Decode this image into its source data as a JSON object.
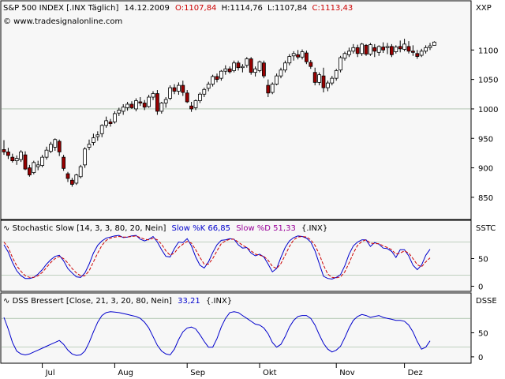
{
  "colors": {
    "panel_bg": "#f7f7f7",
    "frame": "#000000",
    "up_candle": "#ffffff",
    "down_candle": "#990000",
    "red_text": "#cc0000",
    "blue": "#0000cc",
    "purple": "#990099",
    "line_blue": "#0000cc",
    "line_red": "#cc0000",
    "refline": "#88aa88"
  },
  "header": {
    "instrument": "S&P 500 INDEX [.INX  Täglich]",
    "date": "14.12.2009",
    "open": "O:1107,84",
    "high": "H:1114,76",
    "low": "L:1107,84",
    "close": "C:1113,43",
    "watermark": "© www.tradesignalonline.com"
  },
  "stoch_header": {
    "name": "Stochastic Slow [14, 3, 3, 80, 20, Nein]",
    "k_label": "Slow %K 66,85",
    "d_label": "Slow %D 51,33",
    "suffix": "{.INX}"
  },
  "dss_header": {
    "name": "DSS Bressert [Close, 21, 3, 20, 80, Nein]",
    "value": "33,21",
    "suffix": "{.INX}"
  },
  "axis_titles": {
    "price": "XXP",
    "stoch": "SSTC",
    "dss": "DSSE"
  },
  "chart_data": [
    {
      "type": "candlestick",
      "title": "S&P 500 INDEX [.INX  Täglich]",
      "ylim": [
        815,
        1150
      ],
      "y_ticks": [
        "1100",
        "1050",
        "1000",
        "950",
        "900",
        "850"
      ],
      "x_ticks": [
        "Jul",
        "Aug",
        "Sep",
        "Okt",
        "Nov",
        "Dez"
      ],
      "ohlc": [
        [
          931,
          947,
          922,
          927
        ],
        [
          927,
          934,
          915,
          921
        ],
        [
          918,
          924,
          909,
          912
        ],
        [
          912,
          921,
          905,
          916
        ],
        [
          914,
          930,
          910,
          927
        ],
        [
          922,
          928,
          896,
          898
        ],
        [
          900,
          905,
          885,
          888
        ],
        [
          892,
          912,
          889,
          909
        ],
        [
          902,
          912,
          896,
          905
        ],
        [
          904,
          922,
          901,
          918
        ],
        [
          918,
          936,
          914,
          930
        ],
        [
          928,
          944,
          925,
          940
        ],
        [
          935,
          950,
          929,
          948
        ],
        [
          945,
          948,
          920,
          927
        ],
        [
          918,
          922,
          895,
          899
        ],
        [
          890,
          893,
          876,
          882
        ],
        [
          879,
          883,
          868,
          872
        ],
        [
          874,
          890,
          871,
          888
        ],
        [
          885,
          905,
          882,
          902
        ],
        [
          905,
          935,
          900,
          932
        ],
        [
          935,
          948,
          930,
          940
        ],
        [
          943,
          958,
          938,
          951
        ],
        [
          953,
          962,
          946,
          956
        ],
        [
          958,
          974,
          952,
          972
        ],
        [
          972,
          987,
          968,
          980
        ],
        [
          978,
          983,
          970,
          975
        ],
        [
          978,
          996,
          975,
          992
        ],
        [
          993,
          1002,
          988,
          998
        ],
        [
          996,
          1008,
          990,
          1003
        ],
        [
          1002,
          1012,
          997,
          1008
        ],
        [
          1008,
          1013,
          1000,
          1002
        ],
        [
          1000,
          1018,
          996,
          1014
        ],
        [
          1012,
          1020,
          1005,
          1010
        ],
        [
          1010,
          1015,
          998,
          1003
        ],
        [
          1004,
          1024,
          1002,
          1020
        ],
        [
          1020,
          1030,
          1015,
          1026
        ],
        [
          1026,
          1032,
          990,
          996
        ],
        [
          996,
          1012,
          992,
          1010
        ],
        [
          1010,
          1020,
          1002,
          1016
        ],
        [
          1018,
          1040,
          1015,
          1036
        ],
        [
          1036,
          1042,
          1025,
          1030
        ],
        [
          1030,
          1045,
          1024,
          1040
        ],
        [
          1040,
          1048,
          1022,
          1028
        ],
        [
          1027,
          1032,
          1010,
          1012
        ],
        [
          1005,
          1012,
          995,
          1000
        ],
        [
          1002,
          1016,
          998,
          1014
        ],
        [
          1014,
          1028,
          1010,
          1025
        ],
        [
          1025,
          1036,
          1020,
          1033
        ],
        [
          1035,
          1046,
          1030,
          1042
        ],
        [
          1042,
          1058,
          1038,
          1055
        ],
        [
          1055,
          1060,
          1045,
          1050
        ],
        [
          1052,
          1066,
          1048,
          1064
        ],
        [
          1064,
          1074,
          1058,
          1068
        ],
        [
          1068,
          1072,
          1060,
          1063
        ],
        [
          1065,
          1082,
          1062,
          1078
        ],
        [
          1078,
          1082,
          1065,
          1070
        ],
        [
          1070,
          1076,
          1062,
          1072
        ],
        [
          1074,
          1088,
          1070,
          1085
        ],
        [
          1085,
          1088,
          1058,
          1062
        ],
        [
          1062,
          1072,
          1055,
          1068
        ],
        [
          1065,
          1082,
          1062,
          1080
        ],
        [
          1078,
          1082,
          1052,
          1056
        ],
        [
          1040,
          1050,
          1020,
          1027
        ],
        [
          1028,
          1045,
          1025,
          1042
        ],
        [
          1042,
          1060,
          1040,
          1056
        ],
        [
          1056,
          1070,
          1052,
          1066
        ],
        [
          1066,
          1082,
          1062,
          1078
        ],
        [
          1078,
          1093,
          1074,
          1089
        ],
        [
          1090,
          1098,
          1082,
          1094
        ],
        [
          1092,
          1100,
          1084,
          1088
        ],
        [
          1088,
          1101,
          1084,
          1097
        ],
        [
          1095,
          1099,
          1076,
          1080
        ],
        [
          1079,
          1083,
          1068,
          1072
        ],
        [
          1062,
          1070,
          1040,
          1045
        ],
        [
          1045,
          1062,
          1040,
          1058
        ],
        [
          1056,
          1070,
          1028,
          1036
        ],
        [
          1036,
          1048,
          1030,
          1044
        ],
        [
          1044,
          1056,
          1040,
          1052
        ],
        [
          1052,
          1068,
          1048,
          1065
        ],
        [
          1066,
          1090,
          1062,
          1087
        ],
        [
          1086,
          1097,
          1082,
          1094
        ],
        [
          1092,
          1104,
          1088,
          1098
        ],
        [
          1098,
          1110,
          1094,
          1104
        ],
        [
          1104,
          1109,
          1088,
          1094
        ],
        [
          1094,
          1112,
          1090,
          1110
        ],
        [
          1108,
          1110,
          1090,
          1093
        ],
        [
          1093,
          1112,
          1090,
          1109
        ],
        [
          1104,
          1110,
          1088,
          1098
        ],
        [
          1096,
          1108,
          1090,
          1106
        ],
        [
          1105,
          1113,
          1095,
          1100
        ],
        [
          1104,
          1112,
          1093,
          1106
        ],
        [
          1106,
          1110,
          1088,
          1092
        ],
        [
          1097,
          1108,
          1094,
          1105
        ],
        [
          1106,
          1116,
          1096,
          1102
        ],
        [
          1101,
          1119,
          1098,
          1110
        ],
        [
          1106,
          1115,
          1094,
          1098
        ],
        [
          1098,
          1108,
          1090,
          1096
        ],
        [
          1094,
          1100,
          1085,
          1089
        ],
        [
          1091,
          1102,
          1088,
          1098
        ],
        [
          1098,
          1108,
          1094,
          1104
        ],
        [
          1104,
          1112,
          1100,
          1107
        ],
        [
          1107.84,
          1114.76,
          1107.84,
          1113.43
        ]
      ]
    },
    {
      "type": "line",
      "title": "Stochastic Slow [14, 3, 3, 80, 20, Nein]",
      "ylim": [
        -5,
        95
      ],
      "y_ticks": [
        "50",
        "0"
      ],
      "levels": [
        20,
        80
      ],
      "series": [
        {
          "name": "Slow %K",
          "values": [
            75,
            62,
            43,
            28,
            19,
            14,
            14,
            16,
            22,
            30,
            40,
            48,
            54,
            56,
            46,
            32,
            24,
            17,
            16,
            24,
            40,
            60,
            74,
            82,
            87,
            89,
            91,
            92,
            88,
            89,
            91,
            92,
            85,
            82,
            85,
            90,
            80,
            66,
            54,
            53,
            68,
            80,
            79,
            86,
            73,
            53,
            38,
            33,
            44,
            61,
            75,
            83,
            84,
            86,
            85,
            75,
            69,
            70,
            60,
            55,
            58,
            53,
            40,
            26,
            32,
            52,
            70,
            82,
            88,
            91,
            90,
            87,
            80,
            64,
            41,
            18,
            14,
            13,
            16,
            21,
            37,
            58,
            73,
            80,
            84,
            84,
            72,
            79,
            76,
            69,
            68,
            63,
            52,
            66,
            66,
            55,
            38,
            30,
            38,
            56,
            66.85
          ]
        },
        {
          "name": "Slow %D",
          "values": [
            80,
            70,
            52,
            37,
            27,
            19,
            16,
            16,
            19,
            25,
            34,
            43,
            50,
            54,
            50,
            42,
            32,
            24,
            19,
            19,
            28,
            44,
            60,
            74,
            83,
            87,
            89,
            90,
            89,
            89,
            90,
            91,
            88,
            85,
            84,
            87,
            84,
            76,
            64,
            56,
            60,
            70,
            76,
            81,
            78,
            66,
            52,
            40,
            40,
            50,
            64,
            77,
            82,
            85,
            85,
            80,
            74,
            70,
            64,
            58,
            56,
            54,
            47,
            36,
            32,
            41,
            56,
            72,
            84,
            89,
            90,
            89,
            84,
            74,
            58,
            38,
            22,
            16,
            15,
            17,
            26,
            42,
            60,
            74,
            81,
            84,
            78,
            77,
            77,
            73,
            70,
            66,
            58,
            60,
            64,
            60,
            50,
            39,
            35,
            44,
            51.33
          ]
        }
      ]
    },
    {
      "type": "line",
      "title": "DSS Bressert [Close, 21, 3, 20, 80, Nein]",
      "ylim": [
        -10,
        105
      ],
      "y_ticks": [
        "50",
        "0"
      ],
      "levels": [
        20,
        80
      ],
      "series": [
        {
          "name": "DSS",
          "values": [
            82,
            58,
            30,
            12,
            6,
            4,
            6,
            10,
            14,
            18,
            22,
            26,
            30,
            34,
            26,
            14,
            6,
            3,
            4,
            12,
            30,
            52,
            72,
            86,
            92,
            94,
            93,
            92,
            90,
            88,
            86,
            84,
            80,
            72,
            60,
            42,
            24,
            12,
            6,
            4,
            16,
            36,
            52,
            60,
            62,
            58,
            46,
            32,
            20,
            20,
            38,
            62,
            80,
            92,
            94,
            92,
            86,
            80,
            74,
            68,
            66,
            60,
            48,
            30,
            20,
            26,
            42,
            62,
            76,
            84,
            86,
            86,
            80,
            66,
            46,
            28,
            16,
            10,
            14,
            22,
            40,
            60,
            76,
            84,
            88,
            86,
            82,
            84,
            86,
            82,
            80,
            78,
            76,
            76,
            74,
            66,
            52,
            32,
            16,
            20,
            33.21
          ]
        }
      ]
    }
  ]
}
